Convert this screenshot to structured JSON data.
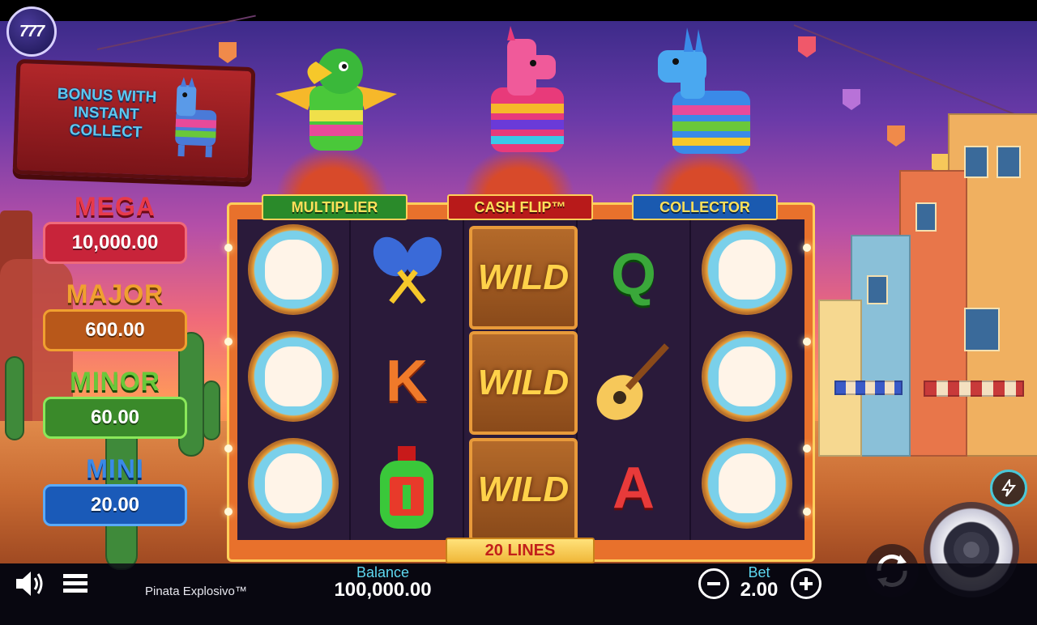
{
  "brand": {
    "logo_text": "777"
  },
  "bonus_sign": {
    "text": "BONUS WITH INSTANT COLLECT"
  },
  "jackpots": [
    {
      "name": "MEGA",
      "value": "10,000.00",
      "title_color": "#e83a4a",
      "box_color": "#c8243a"
    },
    {
      "name": "MAJOR",
      "value": "600.00",
      "title_color": "#f0a030",
      "box_color": "#b8581a"
    },
    {
      "name": "MINOR",
      "value": "60.00",
      "title_color": "#6ac83a",
      "box_color": "#3a8a2a"
    },
    {
      "name": "MINI",
      "value": "20.00",
      "title_color": "#3a8ae8",
      "box_color": "#1a5ab8"
    }
  ],
  "features": [
    {
      "label": "MULTIPLIER",
      "color": "#2a8a2a"
    },
    {
      "label": "CASH FLIP™",
      "color": "#b81a1a"
    },
    {
      "label": "COLLECTOR",
      "color": "#1a5ab0"
    }
  ],
  "reels": [
    [
      "skull",
      "skull",
      "skull"
    ],
    [
      "maracas",
      "K",
      "bottle"
    ],
    [
      "WILD",
      "WILD",
      "WILD"
    ],
    [
      "Q",
      "guitar",
      "A"
    ],
    [
      "skull",
      "skull",
      "skull"
    ]
  ],
  "wild_label": "WILD",
  "paylines_label": "20 LINES",
  "footer": {
    "game_name": "Pinata Explosivo™",
    "balance_label": "Balance",
    "balance_value": "100,000.00",
    "bet_label": "Bet",
    "bet_value": "2.00",
    "minus": "−",
    "plus": "+"
  },
  "icons": [
    "sound-icon",
    "menu-icon",
    "turbo-icon",
    "autoplay-icon",
    "spin-icon",
    "bet-minus-icon",
    "bet-plus-icon"
  ]
}
